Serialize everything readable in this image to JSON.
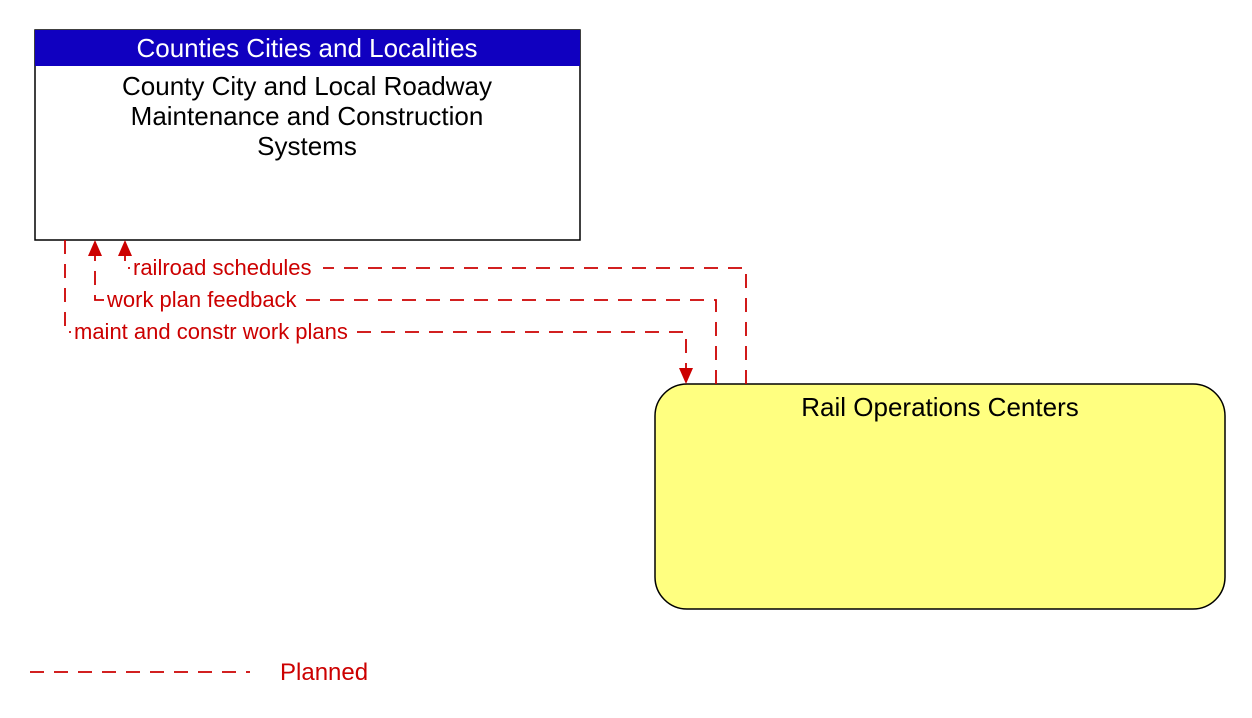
{
  "nodes": {
    "county": {
      "header": "Counties Cities and Localities",
      "body_line1": "County City and Local Roadway",
      "body_line2": "Maintenance and Construction",
      "body_line3": "Systems"
    },
    "rail": {
      "title": "Rail Operations Centers"
    }
  },
  "flows": {
    "f1": "railroad schedules",
    "f2": "work plan feedback",
    "f3": "maint and constr work plans"
  },
  "legend": {
    "planned": "Planned"
  }
}
